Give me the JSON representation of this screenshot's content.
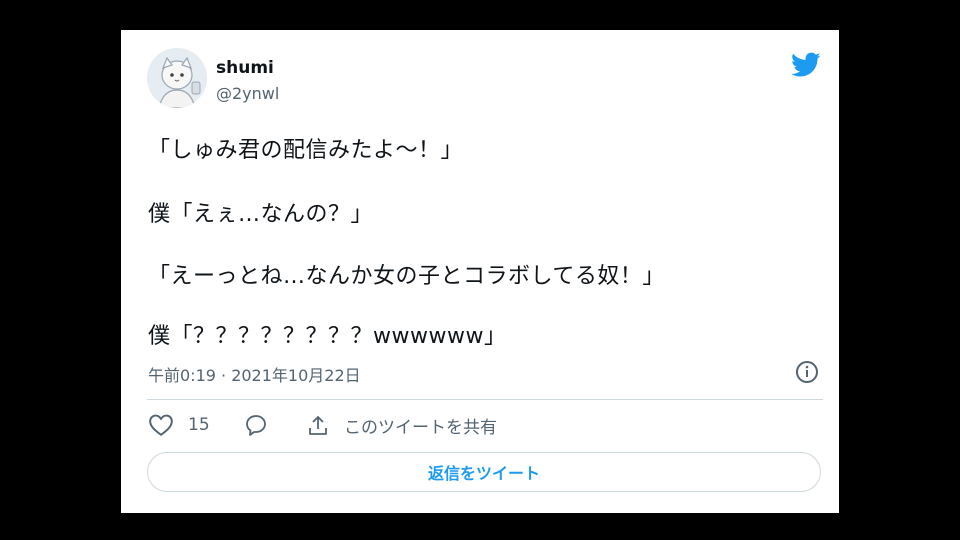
{
  "user": {
    "name": "shumi",
    "handle": "@2ynwl"
  },
  "tweet": {
    "lines": [
      "「しゅみ君の配信みたよ〜！」",
      "僕「えぇ…なんの？」",
      "「えーっとね…なんか女の子とコラボしてる奴！」",
      "僕「？？？？？？？？wwwwww」"
    ],
    "timestamp": "午前0:19 · 2021年10月22日"
  },
  "actions": {
    "like_count": "15",
    "share_label": "このツイートを共有",
    "reply_button_label": "返信をツイート"
  },
  "colors": {
    "accent": "#1d9bf0",
    "text": "#0f1419",
    "muted": "#536471",
    "border": "#cfd9de"
  },
  "icons": [
    "twitter-bird-icon",
    "info-icon",
    "heart-icon",
    "reply-icon",
    "share-icon"
  ]
}
